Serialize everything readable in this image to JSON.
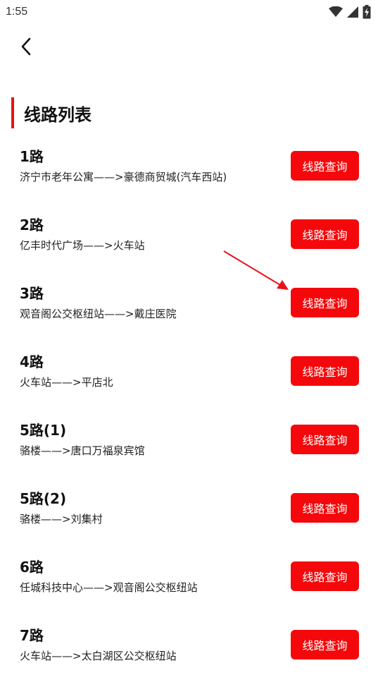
{
  "status_bar": {
    "time": "1:55",
    "icons": [
      "wifi-icon",
      "cell-signal-icon",
      "battery-charging-icon"
    ]
  },
  "header": {
    "back_icon": "chevron-left-icon"
  },
  "section": {
    "title": "线路列表",
    "accent_color": "#e8131a"
  },
  "routes": [
    {
      "name": "1路",
      "desc": "济宁市老年公寓——>豪德商贸城(汽车西站)",
      "button_label": "线路查询"
    },
    {
      "name": "2路",
      "desc": "亿丰时代广场——>火车站",
      "button_label": "线路查询"
    },
    {
      "name": "3路",
      "desc": "观音阁公交枢纽站——>戴庄医院",
      "button_label": "线路查询"
    },
    {
      "name": "4路",
      "desc": "火车站——>平店北",
      "button_label": "线路查询"
    },
    {
      "name": "5路(1)",
      "desc": "骆楼——>唐口万福泉宾馆",
      "button_label": "线路查询"
    },
    {
      "name": "5路(2)",
      "desc": "骆楼——>刘集村",
      "button_label": "线路查询"
    },
    {
      "name": "6路",
      "desc": "任城科技中心——>观音阁公交枢纽站",
      "button_label": "线路查询"
    },
    {
      "name": "7路",
      "desc": "火车站——>太白湖区公交枢纽站",
      "button_label": "线路查询"
    }
  ],
  "colors": {
    "button_bg": "#f4080b",
    "button_text": "#ffffff",
    "annotation_arrow": "#e8131a"
  }
}
